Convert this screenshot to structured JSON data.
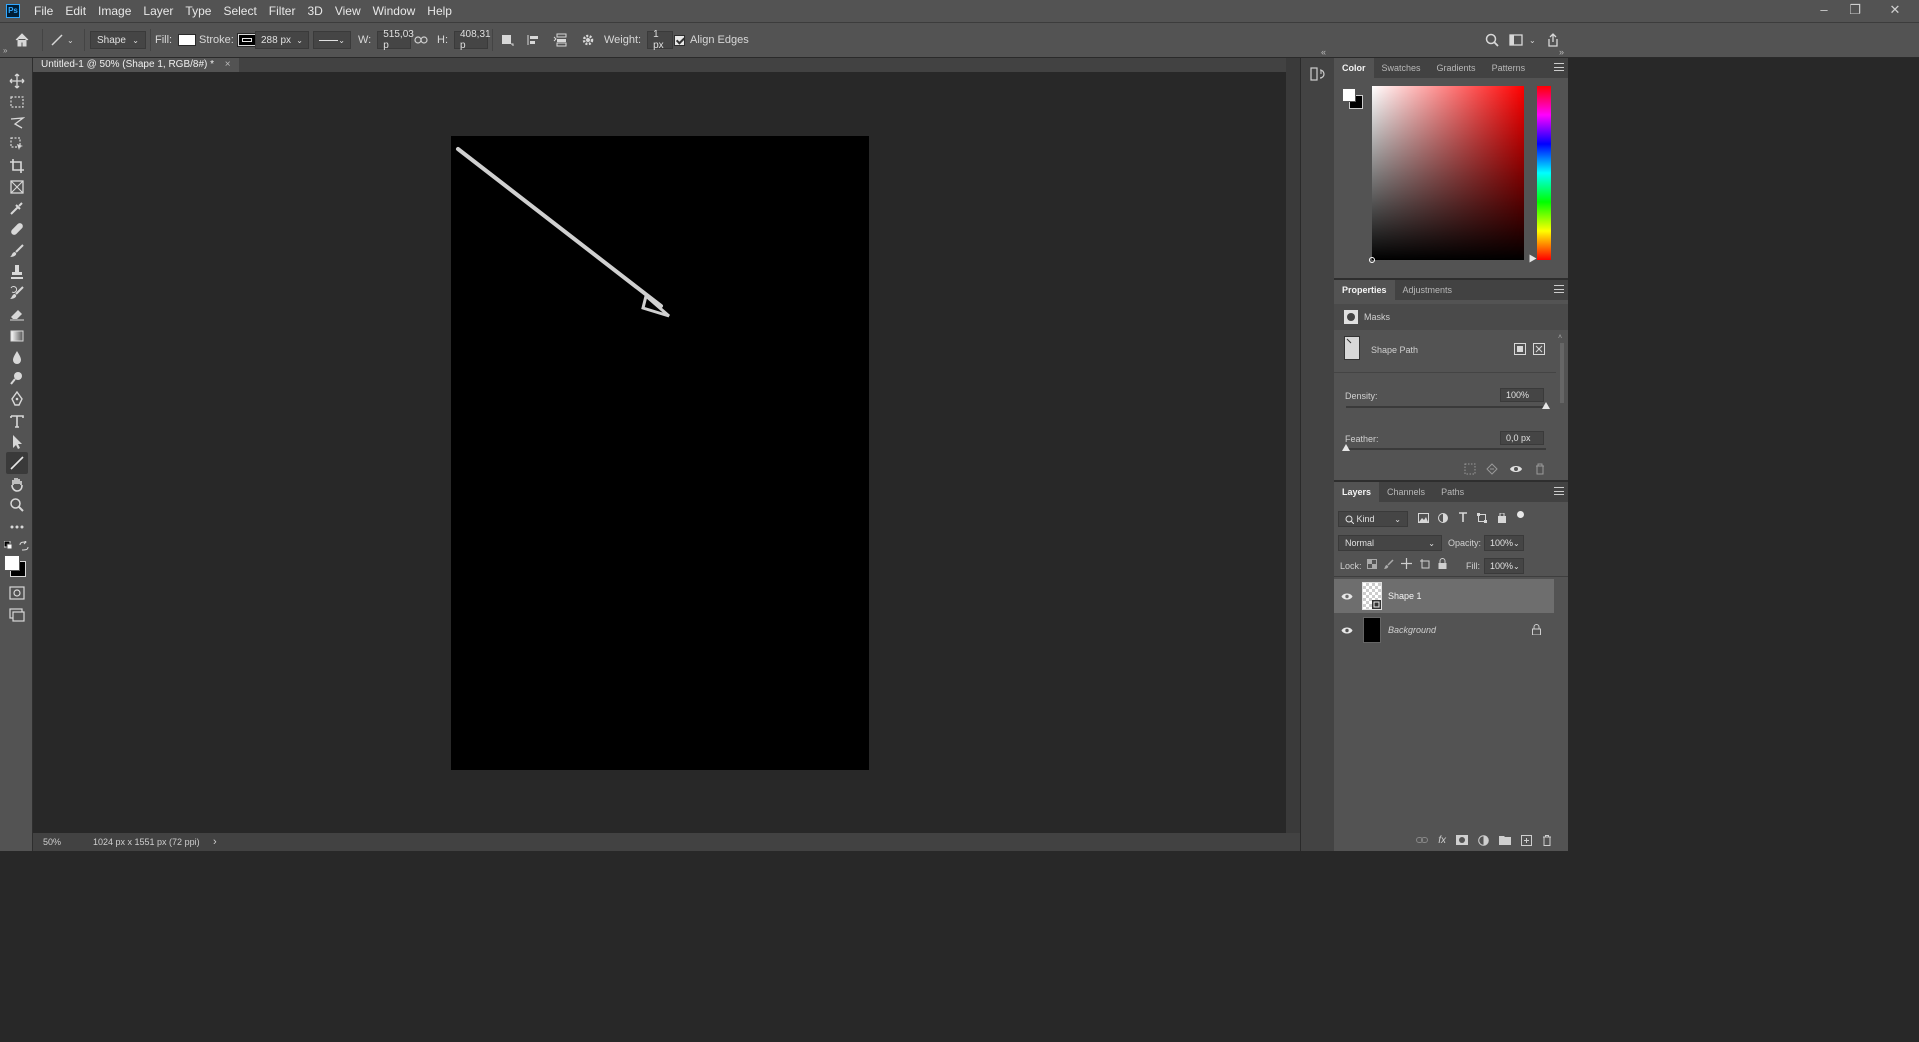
{
  "app": {
    "logo": "Ps"
  },
  "menu": [
    "File",
    "Edit",
    "Image",
    "Layer",
    "Type",
    "Select",
    "Filter",
    "3D",
    "View",
    "Window",
    "Help"
  ],
  "window_controls": {
    "minimize": "–",
    "restore": "❐",
    "close": "✕"
  },
  "options": {
    "mode": "Shape",
    "fill_label": "Fill:",
    "fill_color": "#ffffff",
    "stroke_label": "Stroke:",
    "stroke_width": "288 px",
    "w_label": "W:",
    "w_value": "515,03 р",
    "h_label": "H:",
    "h_value": "408,31 р",
    "weight_label": "Weight:",
    "weight_value": "1 px",
    "align_edges": "Align Edges"
  },
  "document": {
    "tab_title": "Untitled-1 @ 50% (Shape 1, RGB/8#) *",
    "tab_close": "×",
    "canvas_color": "#000000",
    "zoom": "50%",
    "doc_info": "1024 px x 1551 px (72 ppi)",
    "status_arrow": "›"
  },
  "color_panel": {
    "tabs": [
      "Color",
      "Swatches",
      "Gradients",
      "Patterns"
    ],
    "active_tab": "Color",
    "hue_color": "#ff0000"
  },
  "properties_panel": {
    "tabs": [
      "Properties",
      "Adjustments"
    ],
    "masks_label": "Masks",
    "shape_path_label": "Shape Path",
    "density_label": "Density:",
    "density_value": "100%",
    "density_level": 1.0,
    "feather_label": "Feather:",
    "feather_value": "0,0 px",
    "feather_level": 0.0
  },
  "layers_panel": {
    "tabs": [
      "Layers",
      "Channels",
      "Paths"
    ],
    "filter_kind": "Kind",
    "blend_mode": "Normal",
    "opacity_label": "Opacity:",
    "opacity_value": "100%",
    "lock_label": "Lock:",
    "fill_label": "Fill:",
    "fill_value": "100%",
    "layers": [
      {
        "name": "Shape 1",
        "selected": true,
        "locked": false
      },
      {
        "name": "Background",
        "selected": false,
        "locked": true
      }
    ]
  }
}
